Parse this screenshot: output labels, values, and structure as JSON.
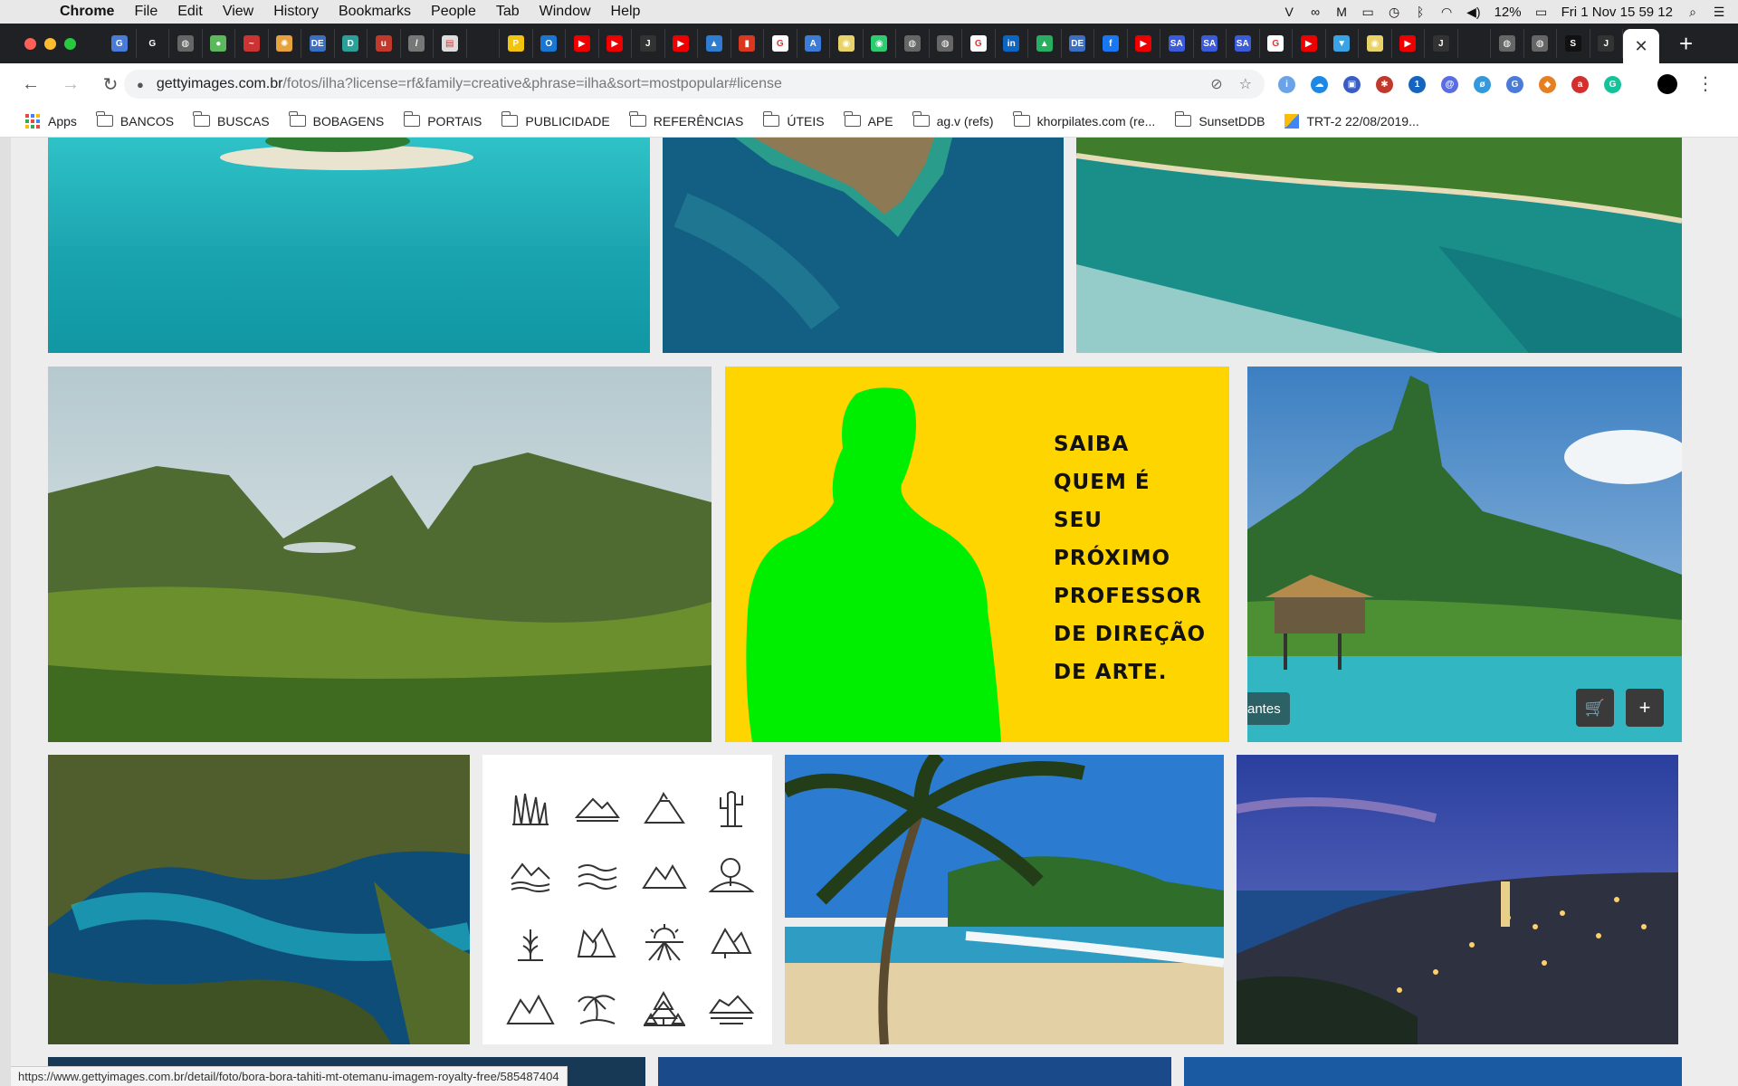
{
  "menubar": {
    "app_name": "Chrome",
    "items": [
      "File",
      "Edit",
      "View",
      "History",
      "Bookmarks",
      "People",
      "Tab",
      "Window",
      "Help"
    ],
    "status": {
      "battery": "12%",
      "clock": "Fri 1 Nov  15 59 12"
    }
  },
  "tabs": {
    "favicons": [
      {
        "icon": "google-translate-icon",
        "color": "#4a7bd8",
        "glyph": "G"
      },
      {
        "icon": "google-icon",
        "color": "#1f2125",
        "glyph": "G"
      },
      {
        "icon": "globe-icon",
        "color": "#666",
        "glyph": "◍"
      },
      {
        "icon": "evernote-icon",
        "color": "#5cb85c",
        "glyph": "●"
      },
      {
        "icon": "mustache-icon",
        "color": "#c33",
        "glyph": "~"
      },
      {
        "icon": "sun-icon",
        "color": "#e6a23c",
        "glyph": "✺"
      },
      {
        "icon": "de-icon",
        "color": "#3a6fc4",
        "glyph": "DE"
      },
      {
        "icon": "d-icon",
        "color": "#2aa198",
        "glyph": "D"
      },
      {
        "icon": "u-icon",
        "color": "#c0392b",
        "glyph": "u"
      },
      {
        "icon": "slash-icon",
        "color": "#777",
        "glyph": "/"
      },
      {
        "icon": "doc-icon",
        "color": "#ddd",
        "glyph": "▤"
      },
      {
        "icon": "blank-icon",
        "color": "#1f2125",
        "glyph": ""
      },
      {
        "icon": "bolt-icon",
        "color": "#f1c40f",
        "glyph": "P"
      },
      {
        "icon": "outlook-icon",
        "color": "#1976d2",
        "glyph": "O"
      },
      {
        "icon": "youtube-icon",
        "color": "#e00",
        "glyph": "▶"
      },
      {
        "icon": "youtube-icon",
        "color": "#e00",
        "glyph": "▶"
      },
      {
        "icon": "jeep-icon",
        "color": "#333",
        "glyph": "J"
      },
      {
        "icon": "youtube-icon",
        "color": "#e00",
        "glyph": "▶"
      },
      {
        "icon": "drive-icon",
        "color": "#2e7dd1",
        "glyph": "▲"
      },
      {
        "icon": "office-icon",
        "color": "#d9381e",
        "glyph": "▮"
      },
      {
        "icon": "google-icon",
        "color": "#fff",
        "glyph": "G"
      },
      {
        "icon": "arch-icon",
        "color": "#3d7bd9",
        "glyph": "A"
      },
      {
        "icon": "eye-icon",
        "color": "#e8d36a",
        "glyph": "◉"
      },
      {
        "icon": "gb-icon",
        "color": "#2ecc71",
        "glyph": "◉"
      },
      {
        "icon": "globe-icon",
        "color": "#666",
        "glyph": "◍"
      },
      {
        "icon": "globe-icon",
        "color": "#666",
        "glyph": "◍"
      },
      {
        "icon": "google-icon",
        "color": "#fff",
        "glyph": "G"
      },
      {
        "icon": "linkedin-icon",
        "color": "#0a66c2",
        "glyph": "in"
      },
      {
        "icon": "mountain-icon",
        "color": "#27ae60",
        "glyph": "▲"
      },
      {
        "icon": "de-icon",
        "color": "#3a6fc4",
        "glyph": "DE"
      },
      {
        "icon": "facebook-icon",
        "color": "#1877f2",
        "glyph": "f"
      },
      {
        "icon": "youtube-icon",
        "color": "#e00",
        "glyph": "▶"
      },
      {
        "icon": "sa-icon",
        "color": "#3b5bdb",
        "glyph": "SA"
      },
      {
        "icon": "sa-icon",
        "color": "#3b5bdb",
        "glyph": "SA"
      },
      {
        "icon": "sa-icon",
        "color": "#3b5bdb",
        "glyph": "SA"
      },
      {
        "icon": "google-icon",
        "color": "#fff",
        "glyph": "G"
      },
      {
        "icon": "youtube-icon",
        "color": "#e00",
        "glyph": "▶"
      },
      {
        "icon": "shirt-icon",
        "color": "#3aa3e3",
        "glyph": "▼"
      },
      {
        "icon": "eye-icon",
        "color": "#e8d36a",
        "glyph": "◉"
      },
      {
        "icon": "youtube-icon",
        "color": "#e00",
        "glyph": "▶"
      },
      {
        "icon": "jeep-icon",
        "color": "#333",
        "glyph": "J"
      },
      {
        "icon": "blank-icon",
        "color": "#1f2125",
        "glyph": ""
      },
      {
        "icon": "globe-icon",
        "color": "#666",
        "glyph": "◍"
      },
      {
        "icon": "globe-icon",
        "color": "#666",
        "glyph": "◍"
      },
      {
        "icon": "s-icon",
        "color": "#111",
        "glyph": "S"
      },
      {
        "icon": "jeep-icon",
        "color": "#333",
        "glyph": "J"
      }
    ],
    "new_tab": "+",
    "close": "✕"
  },
  "toolbar": {
    "back": "←",
    "forward": "→",
    "reload": "↻",
    "url_host": "gettyimages.com.br",
    "url_path": "/fotos/ilha?license=rf&family=creative&phrase=ilha&sort=mostpopular#license",
    "star": "☆",
    "extensions": [
      {
        "icon": "info-icon",
        "color": "#6aa3e8",
        "glyph": "i"
      },
      {
        "icon": "cloud-icon",
        "color": "#1e88e5",
        "glyph": "☁"
      },
      {
        "icon": "square-icon",
        "color": "#3a5cc6",
        "glyph": "▣"
      },
      {
        "icon": "puzzle-icon",
        "color": "#c0392b",
        "glyph": "✱"
      },
      {
        "icon": "1password-icon",
        "color": "#1565c0",
        "glyph": "1"
      },
      {
        "icon": "at-icon",
        "color": "#5b6ee1",
        "glyph": "@"
      },
      {
        "icon": "eye-slash-icon",
        "color": "#3498db",
        "glyph": "ø"
      },
      {
        "icon": "translate-icon",
        "color": "#4a7bd8",
        "glyph": "G"
      },
      {
        "icon": "box-icon",
        "color": "#e67e22",
        "glyph": "◆"
      },
      {
        "icon": "av-icon",
        "color": "#d32f2f",
        "glyph": "a"
      },
      {
        "icon": "grammarly-icon",
        "color": "#15c39a",
        "glyph": "G"
      }
    ],
    "kebab": "⋮"
  },
  "bookmarks": {
    "apps_label": "Apps",
    "folders": [
      "BANCOS",
      "BUSCAS",
      "BOBAGENS",
      "PORTAIS",
      "PUBLICIDADE",
      "REFERÊNCIAS",
      "ÚTEIS",
      "APE",
      "ag.v (refs)",
      "khorpilates.com (re...",
      "SunsetDDB"
    ],
    "last": "TRT-2 22/08/2019..."
  },
  "promo": {
    "lines": [
      "SAIBA",
      "QUEM É",
      "SEU",
      "PRÓXIMO",
      "PROFESSOR",
      "DE DIREÇÃO",
      "DE ARTE."
    ],
    "bg": "#ffd500",
    "silhouette": "#00ee00"
  },
  "hover": {
    "label": "antes",
    "cart": "🛒",
    "add": "+"
  },
  "status_url": "https://www.gettyimages.com.br/detail/foto/bora-bora-tahiti-mt-otemanu-imagem-royalty-free/585487404"
}
